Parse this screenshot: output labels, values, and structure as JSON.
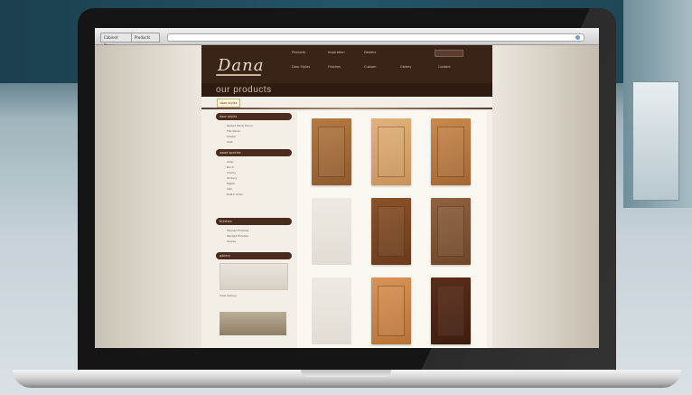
{
  "browser": {
    "tabs": [
      "Cabinet Doors",
      "Products"
    ]
  },
  "site": {
    "brand": "Dana",
    "nav": [
      "Products",
      "Inspiration",
      "Dealers",
      "Door Styles",
      "Finishes",
      "Custom",
      "Gallery",
      "Contact"
    ],
    "page_title": "our products",
    "subtab_label": "door styles",
    "sidebar": {
      "sections": [
        {
          "heading": "door styles",
          "items": [
            "Raised Panel Doors",
            "Flat Panel",
            "Shaker",
            "Slab"
          ]
        },
        {
          "heading": "wood species",
          "items": [
            "Alder",
            "Birch",
            "Cherry",
            "Hickory",
            "Maple",
            "Oak",
            "Rustic Alder"
          ]
        },
        {
          "heading": "finishes",
          "items": [
            "Stained Finishes",
            "Painted Finishes",
            "Glazes"
          ]
        },
        {
          "heading": "gallery",
          "items": [
            "View Gallery"
          ]
        }
      ]
    },
    "doors": [
      {
        "color": "#b67a43",
        "accent": "#8e5a2d"
      },
      {
        "color": "#e1b37c",
        "accent": "#c8935a"
      },
      {
        "color": "#c98a4c",
        "accent": "#a46634"
      },
      {
        "color": "blank",
        "accent": ""
      },
      {
        "color": "#8a5228",
        "accent": "#6a3b1b"
      },
      {
        "color": "#8f6240",
        "accent": "#6f4629"
      },
      {
        "color": "blank",
        "accent": ""
      },
      {
        "color": "#d89456",
        "accent": "#b87438"
      },
      {
        "color": "#5a2d1a",
        "accent": "#3e1c0e"
      }
    ]
  }
}
